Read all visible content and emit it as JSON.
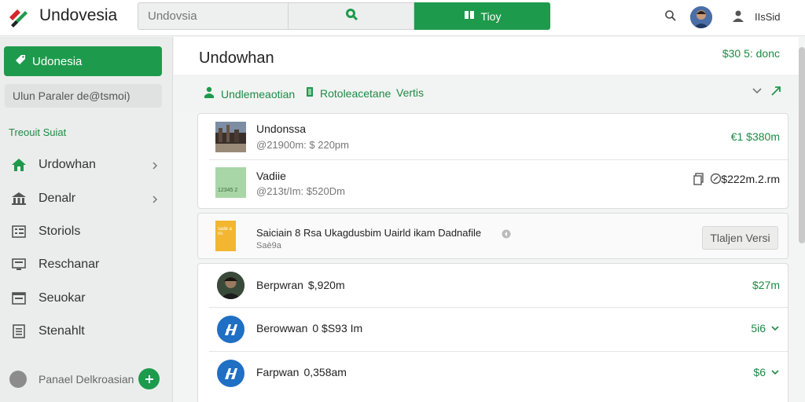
{
  "topbar": {
    "app_name": "Undovesia",
    "search_placeholder": "Undovsia",
    "primary_button": "Tioy",
    "user_name": "IIsSid"
  },
  "sidebar": {
    "primary_button": "Udonesia",
    "search_text": "Ulun Paraler de@tsmoi)",
    "section_title": "Treouit Suiat",
    "items": [
      {
        "label": "Urdowhan",
        "icon": "home-icon"
      },
      {
        "label": "Denalr",
        "icon": "bank-icon"
      },
      {
        "label": "Storiols",
        "icon": "list-icon"
      },
      {
        "label": "Reschanar",
        "icon": "monitor-icon"
      },
      {
        "label": "Seuokar",
        "icon": "board-icon"
      },
      {
        "label": "Stenahlt",
        "icon": "document-icon"
      }
    ],
    "footer_label": "Panael Delkroasian"
  },
  "main": {
    "title": "Undowhan",
    "header_amount": "$30 5: donc",
    "filters": [
      {
        "label": "Undlemeaotian",
        "icon": "person-icon"
      },
      {
        "label": "Rotoleacetane",
        "icon": "bar-icon"
      },
      {
        "label": "Vertis",
        "icon": ""
      }
    ],
    "card1_rows": [
      {
        "title": "Undonssa",
        "sub": "@21900m: $ 220pm",
        "value": "€1 $380m"
      },
      {
        "title": "Vadiie",
        "sub": "@213t/Im: $520Dm",
        "value": "$222m.2.rm"
      }
    ],
    "promo": {
      "thumb_text": "sade a ris",
      "title": "Saiciain 8 Rsa Ukagdusbim Uairld ikam Dadnafile",
      "sub": "Saè9a",
      "button": "Tlaljen Versi"
    },
    "list": [
      {
        "name": "Berpwran",
        "amount": "$,920m",
        "value": "$27m"
      },
      {
        "name": "Berowwan",
        "amount": "0 $S93 Im",
        "value": "5i6"
      },
      {
        "name": "Farpwan",
        "amount": "0,358am",
        "value": "$6"
      }
    ],
    "thumb2_text": "12345 2"
  },
  "colors": {
    "accent": "#1e9a4d",
    "accent_text": "#1e8a45",
    "blue_badge": "#1f6fc4",
    "gold": "#d99b12",
    "promo_thumb": "#f2b630"
  }
}
